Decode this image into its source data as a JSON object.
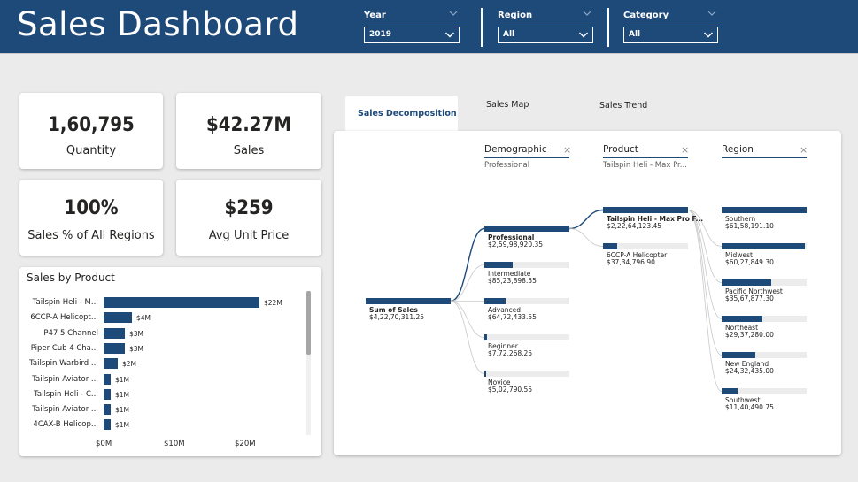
{
  "header": {
    "title": "Sales Dashboard",
    "slicers": [
      {
        "label": "Year",
        "value": "2019"
      },
      {
        "label": "Region",
        "value": "All"
      },
      {
        "label": "Category",
        "value": "All"
      }
    ]
  },
  "kpis": [
    {
      "value": "1,60,795",
      "label": "Quantity"
    },
    {
      "value": "$42.27M",
      "label": "Sales"
    },
    {
      "value": "100%",
      "label": "Sales  %  of All Regions"
    },
    {
      "value": "$259",
      "label": "Avg Unit Price"
    }
  ],
  "sales_by_product": {
    "title": "Sales by Product",
    "axis_ticks": [
      "$0M",
      "$10M",
      "$20M"
    ]
  },
  "chart_data": {
    "type": "bar",
    "orientation": "horizontal",
    "title": "Sales by Product",
    "categories": [
      "Tailspin Heli - M...",
      "6CCP-A Helicopt...",
      "P47 5 Channel",
      "Piper Cub 4 Cha...",
      "Tailspin Warbird ...",
      "Tailspin Aviator ...",
      "Tailspin Heli - C...",
      "Tailspin Aviator ...",
      "4CAX-B Helicop..."
    ],
    "values": [
      22,
      4,
      3,
      3,
      2,
      1,
      1,
      1,
      1
    ],
    "data_labels": [
      "$22M",
      "$4M",
      "$3M",
      "$3M",
      "$2M",
      "$1M",
      "$1M",
      "$1M",
      "$1M"
    ],
    "xlim": [
      0,
      25
    ],
    "xticks": [
      "$0M",
      "$10M",
      "$20M"
    ],
    "grid": false
  },
  "tabs": [
    {
      "label": "Sales Decomposition",
      "active": true
    },
    {
      "label": "Sales Map",
      "active": false
    },
    {
      "label": "Sales Trend",
      "active": false
    }
  ],
  "decomposition": {
    "levels": [
      {
        "name": "Demographic",
        "filter": "Professional"
      },
      {
        "name": "Product",
        "filter": "Tailspin Heli - Max Pr..."
      },
      {
        "name": "Region",
        "filter": ""
      }
    ],
    "close_glyph": "×",
    "root": {
      "name": "Sum of Sales",
      "value": "$4,22,70,311.25",
      "fill": 1.0
    },
    "demographic": [
      {
        "name": "Professional",
        "value": "$2,59,98,920.35",
        "fill": 1.0,
        "selected": true
      },
      {
        "name": "Intermediate",
        "value": "$85,23,898.55",
        "fill": 0.33
      },
      {
        "name": "Advanced",
        "value": "$64,72,433.55",
        "fill": 0.25
      },
      {
        "name": "Beginner",
        "value": "$7,72,268.25",
        "fill": 0.03
      },
      {
        "name": "Novice",
        "value": "$5,02,790.55",
        "fill": 0.02
      }
    ],
    "product": [
      {
        "name": "Tailspin Heli - Max Pro F...",
        "value": "$2,22,64,123.45",
        "fill": 1.0,
        "selected": true
      },
      {
        "name": "6CCP-A Helicopter",
        "value": "$37,34,796.90",
        "fill": 0.17
      }
    ],
    "region": [
      {
        "name": "Southern",
        "value": "$61,58,191.10",
        "fill": 1.0
      },
      {
        "name": "Midwest",
        "value": "$60,27,849.30",
        "fill": 0.98
      },
      {
        "name": "Pacific Northwest",
        "value": "$35,67,877.30",
        "fill": 0.58
      },
      {
        "name": "Northeast",
        "value": "$29,37,280.00",
        "fill": 0.48
      },
      {
        "name": "New England",
        "value": "$24,32,435.00",
        "fill": 0.4
      },
      {
        "name": "Southwest",
        "value": "$11,40,490.75",
        "fill": 0.19
      }
    ]
  },
  "colors": {
    "header_bg": "#1e4a7a",
    "accent": "#1e4a7a",
    "track": "#ececec"
  }
}
